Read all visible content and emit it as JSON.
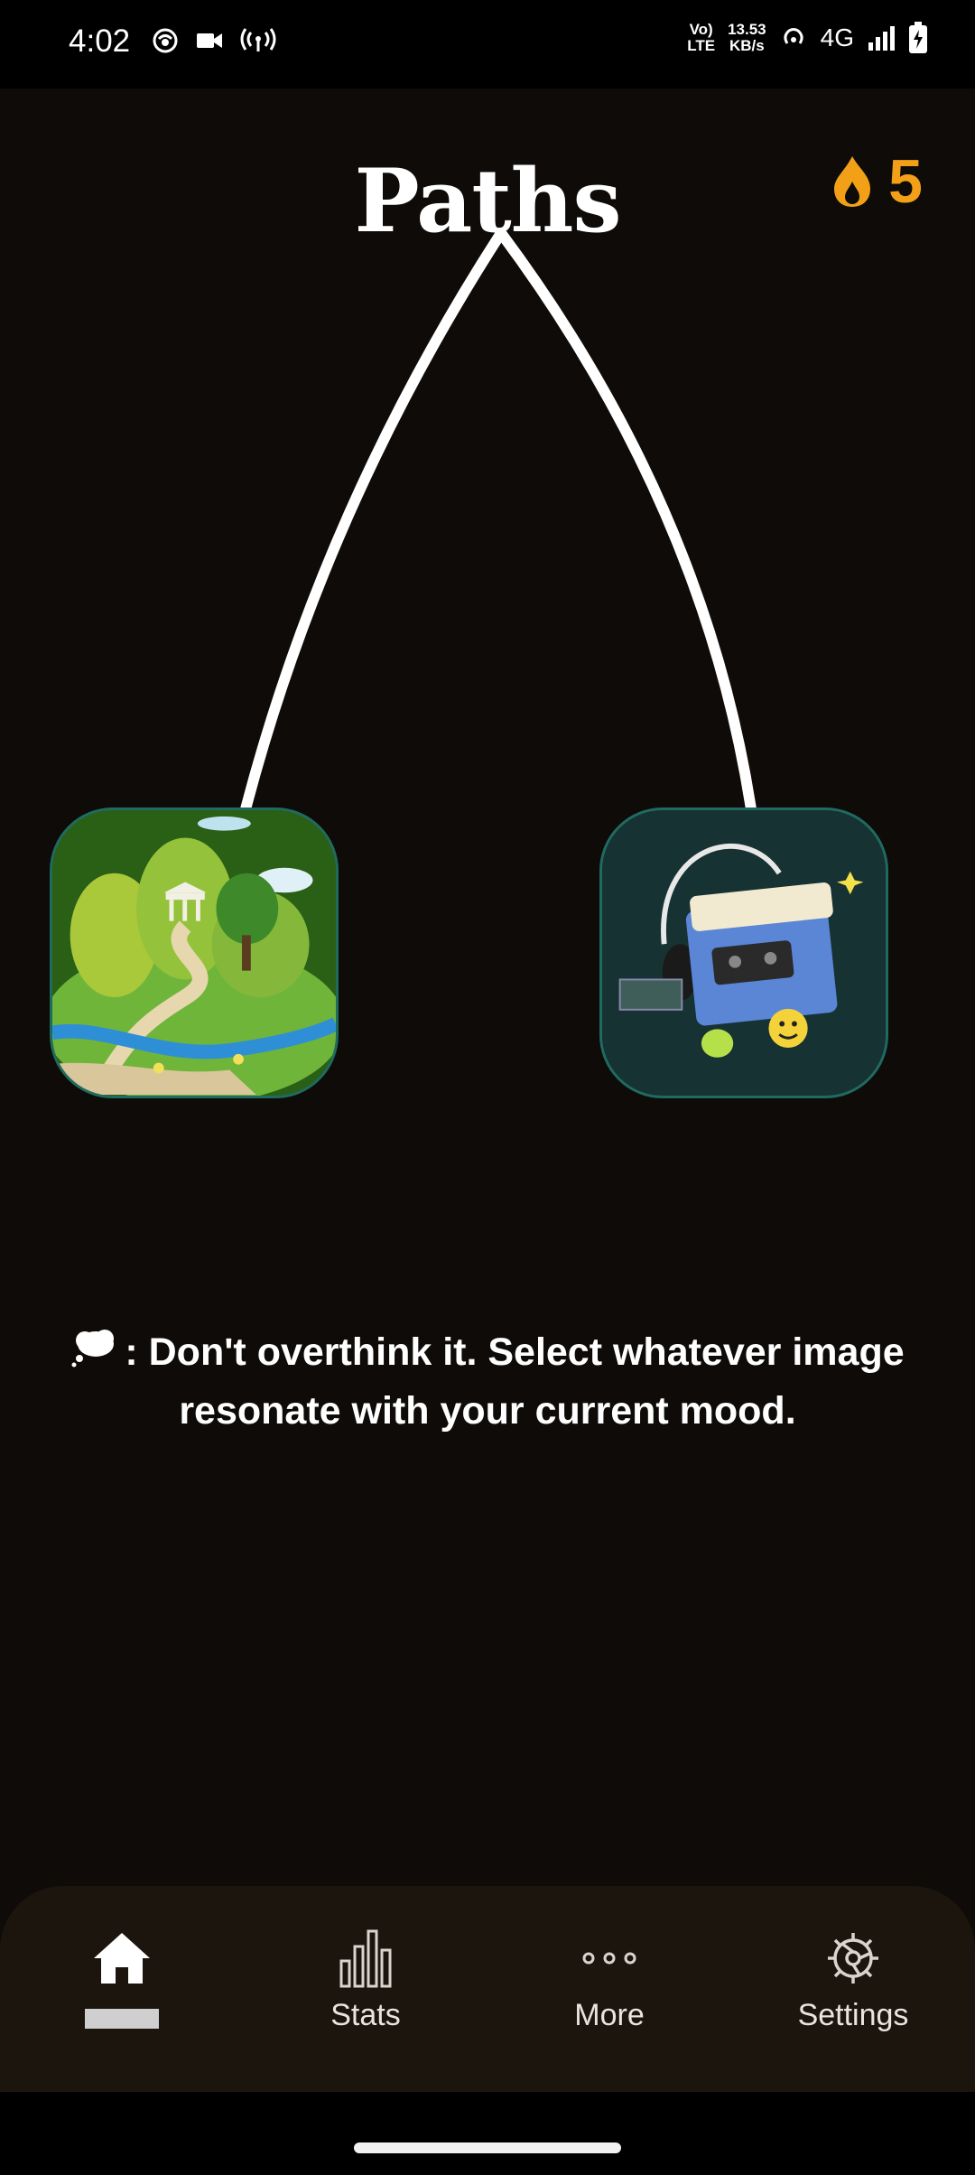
{
  "status_bar": {
    "time": "4:02",
    "volte_line1": "Vo)",
    "volte_line2": "LTE",
    "speed_value": "13.53",
    "speed_unit": "KB/s",
    "network": "4G"
  },
  "header": {
    "title": "Paths",
    "streak_count": "5",
    "streak_icon": "flame-icon"
  },
  "choices": [
    {
      "name": "park-landscape-image",
      "description": "hill"
    },
    {
      "name": "cassette-player-image",
      "description": "retro"
    }
  ],
  "hint": {
    "icon": "thought-bubble-icon",
    "text": ": Don't overthink it. Select whatever image resonate with your current mood."
  },
  "bottom_nav": {
    "items": [
      {
        "id": "home",
        "label": "",
        "icon": "home-icon",
        "active": true
      },
      {
        "id": "stats",
        "label": "Stats",
        "icon": "bar-chart-icon"
      },
      {
        "id": "more",
        "label": "More",
        "icon": "more-dots-icon"
      },
      {
        "id": "settings",
        "label": "Settings",
        "icon": "gear-icon"
      }
    ]
  },
  "colors": {
    "background": "#0e0b08",
    "accent_streak": "#f2a018",
    "nav_background": "#1c150d"
  }
}
